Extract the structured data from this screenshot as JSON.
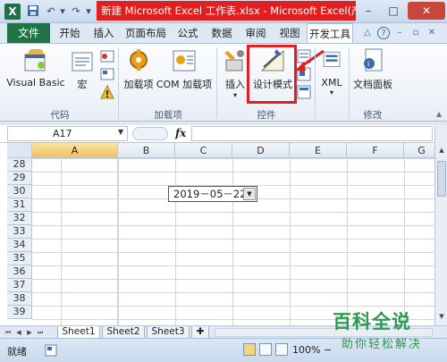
{
  "window": {
    "title": "新建 Microsoft Excel 工作表.xlsx - Microsoft Excel(产..."
  },
  "quick_access": {
    "undo": "↶",
    "redo": "↷",
    "customize": "▾"
  },
  "tabs": [
    "文件",
    "开始",
    "插入",
    "页面布局",
    "公式",
    "数据",
    "审阅",
    "视图",
    "开发工具"
  ],
  "active_tab": "开发工具",
  "ribbon": {
    "groups": [
      {
        "label": "代码",
        "buttons": [
          "Visual Basic",
          "宏"
        ]
      },
      {
        "label": "加载项",
        "buttons": [
          "加载项",
          "COM 加载项"
        ]
      },
      {
        "label": "控件",
        "buttons": [
          "插入",
          "设计模式"
        ]
      },
      {
        "label": "",
        "buttons": [
          "XML"
        ]
      },
      {
        "label": "修改",
        "buttons": [
          "文档面板"
        ]
      }
    ]
  },
  "formula_bar": {
    "name_box": "A17",
    "fx": "fx",
    "value": ""
  },
  "sheet": {
    "columns": [
      "A",
      "B",
      "C",
      "D",
      "E",
      "F",
      "G"
    ],
    "selected_column": "A",
    "rows": [
      "28",
      "29",
      "30",
      "31",
      "32",
      "33",
      "34",
      "35",
      "36",
      "37",
      "38",
      "39"
    ],
    "date_control_value": "2019－05－22"
  },
  "sheet_tabs": [
    "Sheet1",
    "Sheet2",
    "Sheet3"
  ],
  "active_sheet": "Sheet1",
  "status_bar": {
    "status": "就绪",
    "zoom": "100%"
  },
  "watermark": {
    "main": "百科全说",
    "sub": "助你轻松解决"
  },
  "colors": {
    "excel_green": "#217346",
    "highlight_red": "#e02020",
    "watermark_green": "#2e9a4f"
  },
  "icons": {
    "app": "excel-icon",
    "help": "help-icon",
    "minimize_ribbon": "ribbon-minimize-icon"
  }
}
